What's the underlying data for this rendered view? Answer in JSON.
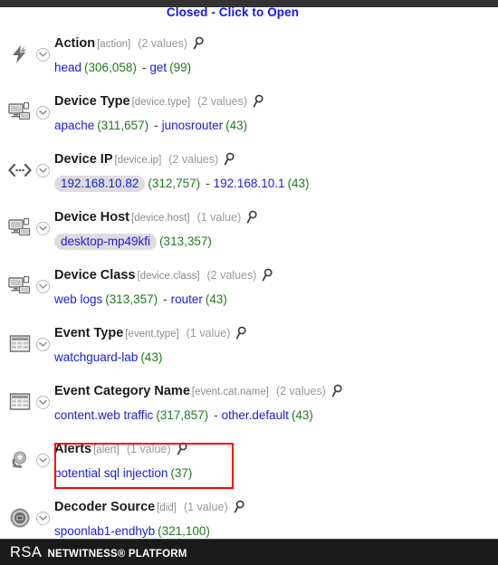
{
  "topbar": {
    "present": true
  },
  "banner": {
    "label": "Closed - Click to Open",
    "color": "#1414ff"
  },
  "meta_keys": [
    {
      "icon": "lightning-bolt-icon",
      "name": "Action",
      "raw": "[action]",
      "count_label": "(2 values)",
      "values": [
        {
          "name": "head",
          "count": "(306,058)",
          "chip": false
        },
        {
          "name": "get",
          "count": "(99)",
          "chip": false
        }
      ]
    },
    {
      "icon": "monitor-devices-icon",
      "name": "Device Type",
      "raw": "[device.type]",
      "count_label": "(2 values)",
      "values": [
        {
          "name": "apache",
          "count": "(311,657)",
          "chip": false
        },
        {
          "name": "junosrouter",
          "count": "(43)",
          "chip": false
        }
      ]
    },
    {
      "icon": "ip-arrows-icon",
      "name": "Device IP",
      "raw": "[device.ip]",
      "count_label": "(2 values)",
      "values": [
        {
          "name": "192.168.10.82",
          "count": "(312,757)",
          "chip": true
        },
        {
          "name": "192.168.10.1",
          "count": "(43)",
          "chip": false
        }
      ]
    },
    {
      "icon": "monitor-devices-icon",
      "name": "Device Host",
      "raw": "[device.host]",
      "count_label": "(1 value)",
      "values": [
        {
          "name": "desktop-mp49kfi",
          "count": "(313,357)",
          "chip": true
        }
      ]
    },
    {
      "icon": "monitor-devices-icon",
      "name": "Device Class",
      "raw": "[device.class]",
      "count_label": "(2 values)",
      "values": [
        {
          "name": "web logs",
          "count": "(313,357)",
          "chip": false
        },
        {
          "name": "router",
          "count": "(43)",
          "chip": false
        }
      ]
    },
    {
      "icon": "table-grid-icon",
      "name": "Event Type",
      "raw": "[event.type]",
      "count_label": "(1 value)",
      "values": [
        {
          "name": "watchguard-lab",
          "count": "(43)",
          "chip": false
        }
      ]
    },
    {
      "icon": "table-grid-icon",
      "name": "Event Category Name",
      "raw": "[event.cat.name]",
      "count_label": "(2 values)",
      "values": [
        {
          "name": "content.web traffic",
          "count": "(317,857)",
          "chip": false
        },
        {
          "name": "other.default",
          "count": "(43)",
          "chip": false
        }
      ]
    },
    {
      "icon": "alarm-bell-icon",
      "name": "Alerts",
      "raw": "[alert]",
      "count_label": "(1 value)",
      "highlighted": true,
      "values": [
        {
          "name": "potential sql injection",
          "count": "(37)",
          "chip": false
        }
      ]
    },
    {
      "icon": "decoder-disc-icon",
      "name": "Decoder Source",
      "raw": "[did]",
      "count_label": "(1 value)",
      "values": [
        {
          "name": "spoonlab1-endhyb",
          "count": "(321,100)",
          "chip": false
        }
      ]
    }
  ],
  "highlight": {
    "color": "#ff0000",
    "target": "Alerts"
  },
  "footer": {
    "brand": "RSA",
    "product": "NETWITNESS® PLATFORM"
  }
}
